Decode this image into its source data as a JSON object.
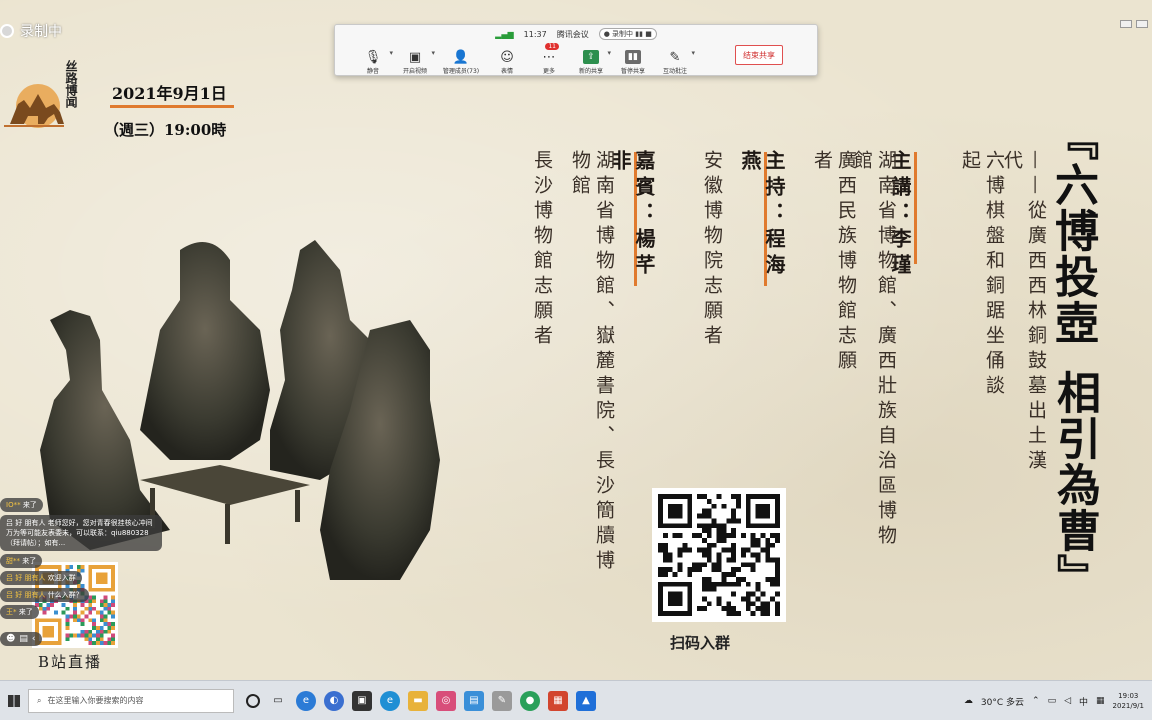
{
  "recording_tag": {
    "label": "录制中"
  },
  "meeting": {
    "signal_icon": "signal-bars-icon",
    "time": "11:37",
    "app_name": "腾讯会议",
    "recording_label": "录制中",
    "tools": [
      {
        "label": "静音",
        "icon": "microphone-icon",
        "caret": true
      },
      {
        "label": "开启视频",
        "icon": "video-off-icon",
        "caret": true
      },
      {
        "label": "管理成员(73)",
        "icon": "person-icon",
        "caret": false
      },
      {
        "label": "表情",
        "icon": "emoji-icon",
        "caret": false
      },
      {
        "label": "更多",
        "icon": "more-icon",
        "caret": false,
        "badge": "11"
      },
      {
        "label": "新的共享",
        "icon": "share-icon",
        "caret": true
      },
      {
        "label": "暂停共享",
        "icon": "pause-icon",
        "caret": false
      },
      {
        "label": "互动批注",
        "icon": "annotate-icon",
        "caret": true
      }
    ],
    "end_share_label": "结束共享"
  },
  "poster": {
    "logo_text": "丝路博闻",
    "date": "2021年9月1日",
    "weekday_time": "（週三）19:00時",
    "title_open": "『",
    "title_line1": "六博投壺",
    "title_line2": "相引為曹",
    "title_close": "』",
    "subtitle_a": "——從廣西西林銅鼓墓出土漢代",
    "subtitle_b": "六博棋盤和銅踞坐俑談起",
    "speaker_label": "主講：李瑾",
    "speaker_org_a": "湖南省博物館、廣西壯族自治區博物館",
    "speaker_org_b": "廣西民族博物館志願者",
    "host_label": "主持：程海燕",
    "host_org": "安徽博物院志願者",
    "guest_label": "嘉賓：楊芊非",
    "guest_org_a": "湖南省博物館、嶽麓書院、長沙簡牘博物館",
    "guest_org_b": "長沙博物館志願者",
    "qr_caption": "扫码入群",
    "bili_label": "B站直播"
  },
  "chat": {
    "messages": [
      {
        "name": "IO**",
        "text": "来了"
      },
      {
        "name": "吕 好 朋有人",
        "text": "老师您好，您对青春很挂核心冲间万为等可能友表委未，可以联系：qiu880328（拜请帖）；如有..."
      },
      {
        "name": "甜**",
        "text": "来了"
      },
      {
        "name": "吕 好 朋有人",
        "text": "欢迎入群"
      },
      {
        "name": "吕 好 朋有人",
        "text": "什么入群？"
      },
      {
        "name": "王*",
        "text": "来了"
      }
    ]
  },
  "taskbar": {
    "search_placeholder": "在这里输入你要搜索的内容",
    "weather": "30°C 多云",
    "ime": "中",
    "time": "19:03",
    "date": "2021/9/1"
  },
  "colors": {
    "accent": "#e07a2e",
    "paper": "#ebe4d0",
    "ink": "#111111"
  }
}
